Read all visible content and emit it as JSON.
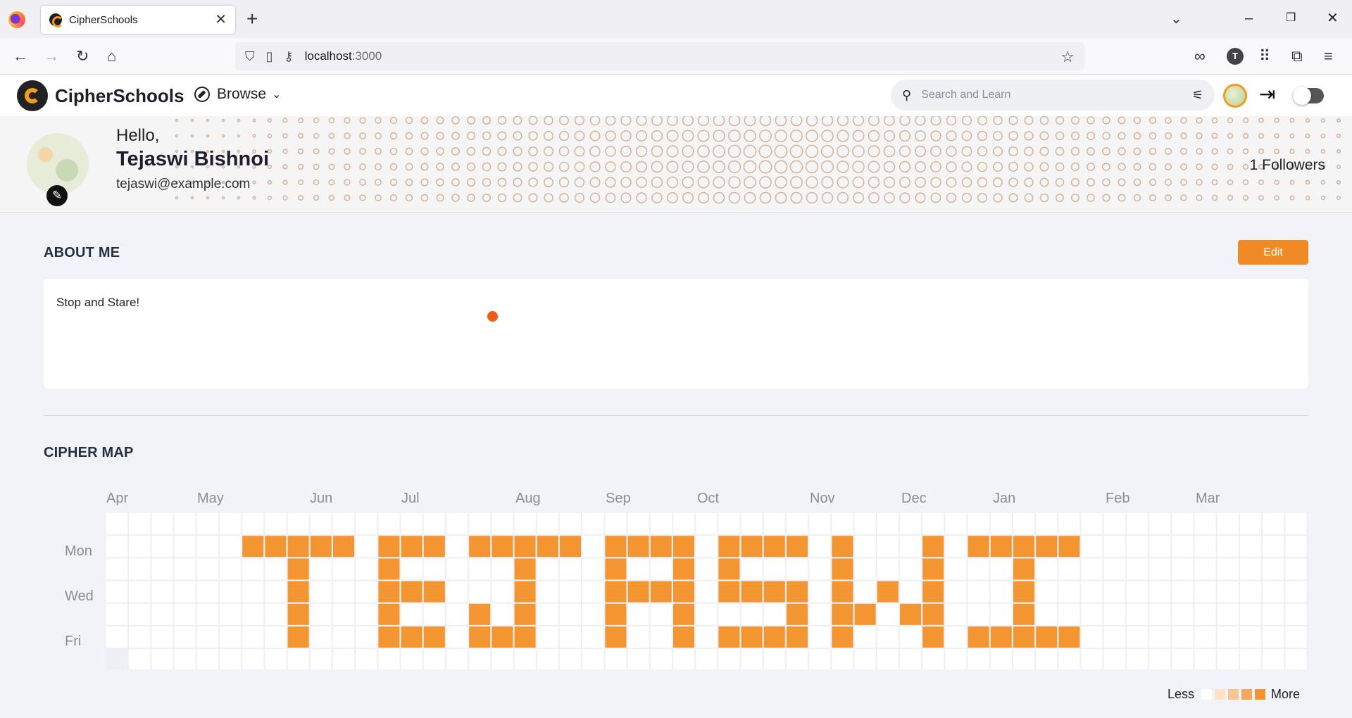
{
  "browser": {
    "tab_title": "CipherSchools",
    "url_host": "localhost",
    "url_port": ":3000"
  },
  "app": {
    "brand": "CipherSchools",
    "browse_label": "Browse",
    "search_placeholder": "Search and Learn"
  },
  "profile": {
    "greeting": "Hello,",
    "name": "Tejaswi Bishnoi",
    "email": "tejaswi@example.com",
    "followers": "1 Followers"
  },
  "about": {
    "title": "ABOUT ME",
    "edit_label": "Edit",
    "text": "Stop and Stare!"
  },
  "cipher_map": {
    "title": "CIPHER MAP",
    "months": [
      "Apr",
      "May",
      "Jun",
      "Jul",
      "Aug",
      "Sep",
      "Oct",
      "Nov",
      "Dec",
      "Jan",
      "Feb",
      "Mar"
    ],
    "day_labels": [
      "Mon",
      "Wed",
      "Fri"
    ],
    "legend_less": "Less",
    "legend_more": "More",
    "colors": {
      "empty": "#ffffff",
      "level1": "#fde3c6",
      "level2": "#f9c48f",
      "level3": "#f5a85c",
      "level4": "#f39531"
    },
    "active_cells": [
      [
        6,
        1
      ],
      [
        7,
        1
      ],
      [
        8,
        1
      ],
      [
        9,
        1
      ],
      [
        10,
        1
      ],
      [
        8,
        2
      ],
      [
        8,
        3
      ],
      [
        8,
        4
      ],
      [
        8,
        5
      ],
      [
        12,
        1
      ],
      [
        13,
        1
      ],
      [
        14,
        1
      ],
      [
        12,
        2
      ],
      [
        12,
        3
      ],
      [
        13,
        3
      ],
      [
        14,
        3
      ],
      [
        12,
        4
      ],
      [
        12,
        5
      ],
      [
        13,
        5
      ],
      [
        14,
        5
      ],
      [
        16,
        1
      ],
      [
        17,
        1
      ],
      [
        18,
        1
      ],
      [
        19,
        1
      ],
      [
        20,
        1
      ],
      [
        18,
        2
      ],
      [
        18,
        3
      ],
      [
        16,
        4
      ],
      [
        18,
        4
      ],
      [
        16,
        5
      ],
      [
        17,
        5
      ],
      [
        18,
        5
      ],
      [
        22,
        1
      ],
      [
        23,
        1
      ],
      [
        24,
        1
      ],
      [
        25,
        1
      ],
      [
        22,
        2
      ],
      [
        25,
        2
      ],
      [
        22,
        3
      ],
      [
        23,
        3
      ],
      [
        24,
        3
      ],
      [
        25,
        3
      ],
      [
        22,
        4
      ],
      [
        25,
        4
      ],
      [
        22,
        5
      ],
      [
        25,
        5
      ],
      [
        27,
        1
      ],
      [
        28,
        1
      ],
      [
        29,
        1
      ],
      [
        30,
        1
      ],
      [
        27,
        2
      ],
      [
        27,
        3
      ],
      [
        28,
        3
      ],
      [
        29,
        3
      ],
      [
        30,
        3
      ],
      [
        30,
        4
      ],
      [
        27,
        5
      ],
      [
        28,
        5
      ],
      [
        29,
        5
      ],
      [
        30,
        5
      ],
      [
        32,
        1
      ],
      [
        36,
        1
      ],
      [
        32,
        2
      ],
      [
        36,
        2
      ],
      [
        32,
        3
      ],
      [
        34,
        3
      ],
      [
        36,
        3
      ],
      [
        32,
        4
      ],
      [
        33,
        4
      ],
      [
        35,
        4
      ],
      [
        36,
        4
      ],
      [
        32,
        5
      ],
      [
        36,
        5
      ],
      [
        38,
        1
      ],
      [
        39,
        1
      ],
      [
        40,
        1
      ],
      [
        41,
        1
      ],
      [
        42,
        1
      ],
      [
        40,
        2
      ],
      [
        40,
        3
      ],
      [
        40,
        4
      ],
      [
        38,
        5
      ],
      [
        39,
        5
      ],
      [
        40,
        5
      ],
      [
        41,
        5
      ],
      [
        42,
        5
      ]
    ]
  }
}
